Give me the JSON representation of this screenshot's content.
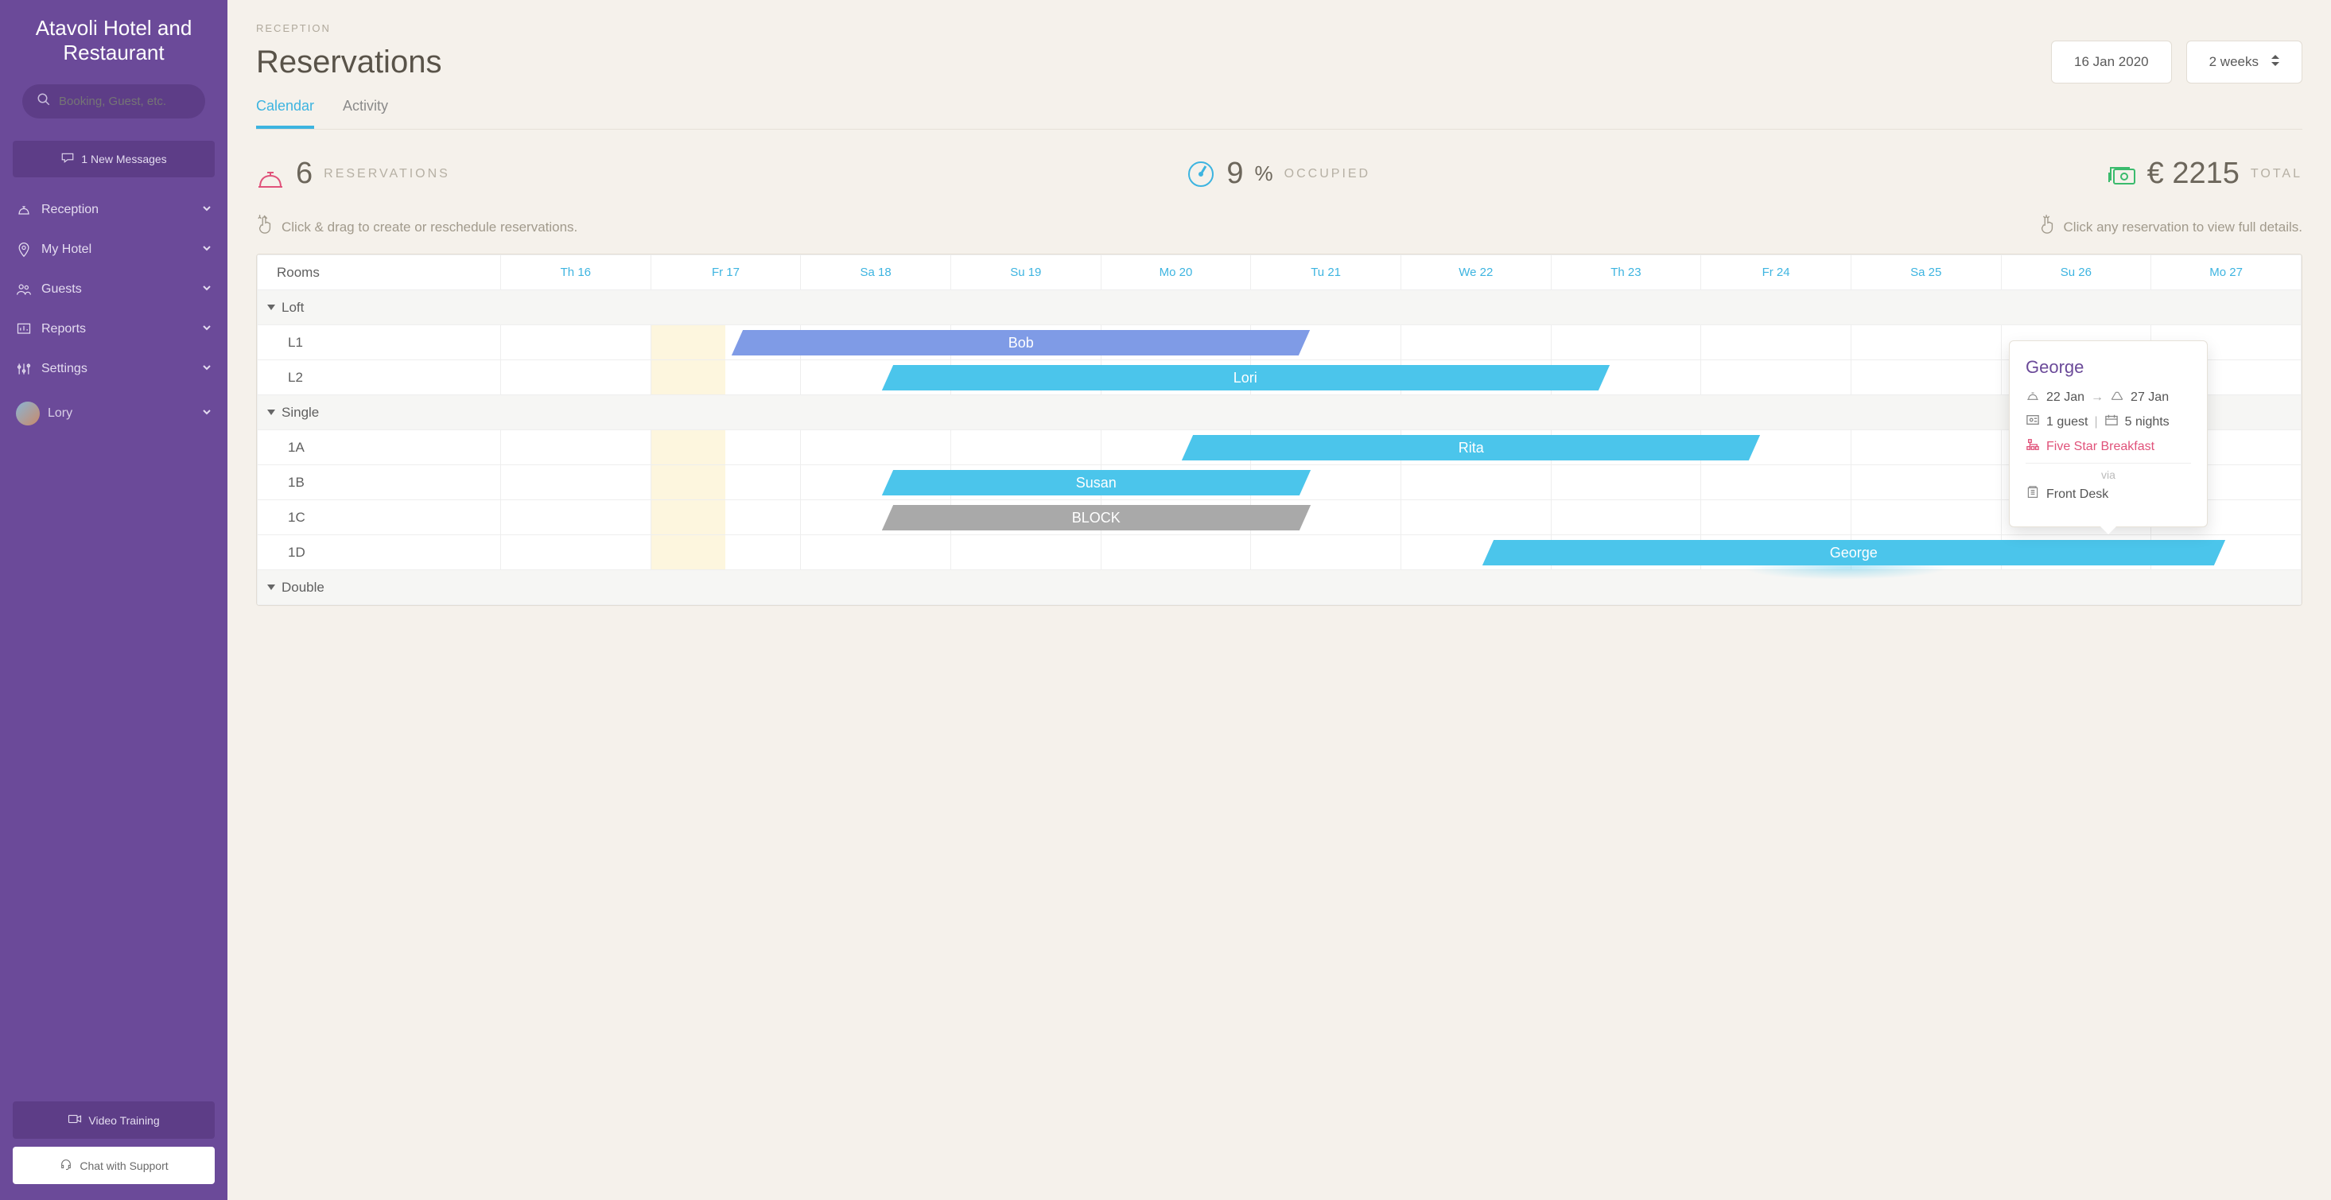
{
  "sidebar": {
    "title": "Atavoli Hotel and Restaurant",
    "search_placeholder": "Booking, Guest, etc.",
    "messages_label": "1 New Messages",
    "nav": [
      {
        "label": "Reception"
      },
      {
        "label": "My Hotel"
      },
      {
        "label": "Guests"
      },
      {
        "label": "Reports"
      },
      {
        "label": "Settings"
      }
    ],
    "user_name": "Lory",
    "video_label": "Video Training",
    "chat_label": "Chat with Support"
  },
  "header": {
    "breadcrumb": "RECEPTION",
    "title": "Reservations",
    "date": "16 Jan 2020",
    "range": "2 weeks",
    "tabs": {
      "calendar": "Calendar",
      "activity": "Activity"
    }
  },
  "stats": {
    "reservations": {
      "value": "6",
      "label": "RESERVATIONS"
    },
    "occupied": {
      "value": "9",
      "pct": "%",
      "label": "OCCUPIED"
    },
    "total": {
      "currency": "€",
      "value": "2215",
      "label": "TOTAL"
    }
  },
  "hints": {
    "drag": "Click & drag to create or reschedule reservations.",
    "click": "Click any reservation to view full details."
  },
  "calendar": {
    "rooms_header": "Rooms",
    "days": [
      "Th 16",
      "Fr 17",
      "Sa 18",
      "Su 19",
      "Mo 20",
      "Tu 21",
      "We 22",
      "Th 23",
      "Fr 24",
      "Sa 25",
      "Su 26",
      "Mo 27"
    ],
    "sections": {
      "loft": "Loft",
      "single": "Single",
      "double": "Double"
    },
    "rooms": {
      "l1": "L1",
      "l2": "L2",
      "r1a": "1A",
      "r1b": "1B",
      "r1c": "1C",
      "r1d": "1D"
    },
    "bars": {
      "bob": "Bob",
      "lori": "Lori",
      "rita": "Rita",
      "susan": "Susan",
      "block": "BLOCK",
      "george": "George"
    }
  },
  "tooltip": {
    "name": "George",
    "checkin": "22 Jan",
    "checkout": "27 Jan",
    "guests": "1 guest",
    "sep": "|",
    "nights": "5 nights",
    "plan": "Five Star Breakfast",
    "via_label": "via",
    "source": "Front Desk"
  }
}
